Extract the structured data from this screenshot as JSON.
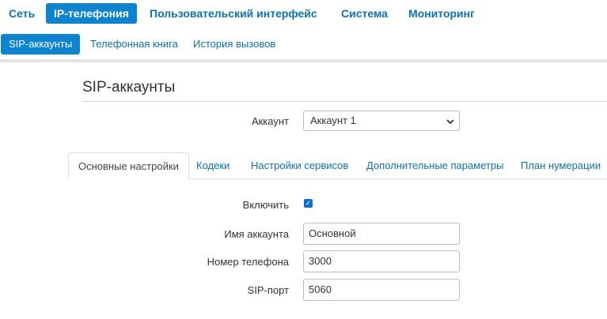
{
  "top_nav": {
    "items": [
      {
        "label": "Сеть"
      },
      {
        "label": "IP-телефония",
        "active": true
      },
      {
        "label": "Пользовательский интерфейс"
      },
      {
        "label": "Система"
      },
      {
        "label": "Мониторинг"
      }
    ]
  },
  "sub_nav": {
    "items": [
      {
        "label": "SIP-аккаунты",
        "active": true
      },
      {
        "label": "Телефонная книга"
      },
      {
        "label": "История вызовов"
      }
    ]
  },
  "page": {
    "title": "SIP-аккаунты",
    "account_label": "Аккаунт",
    "account_selected": "Аккаунт 1"
  },
  "tabs": [
    {
      "label": "Основные настройки",
      "active": true
    },
    {
      "label": "Кодеки"
    },
    {
      "label": "Настройки сервисов"
    },
    {
      "label": "Дополнительные параметры"
    },
    {
      "label": "План нумерации"
    }
  ],
  "form": {
    "enable_label": "Включить",
    "enable_checked": true,
    "account_name_label": "Имя аккаунта",
    "account_name_value": "Основной",
    "phone_label": "Номер телефона",
    "phone_value": "3000",
    "sip_port_label": "SIP-порт",
    "sip_port_value": "5060"
  },
  "colors": {
    "accent": "#0d84cf",
    "link": "#0a72b8",
    "checkbox": "#0d6fd6"
  },
  "icons": {
    "select_chevron": "chevron-down-icon",
    "checkbox_check": "check-icon"
  }
}
